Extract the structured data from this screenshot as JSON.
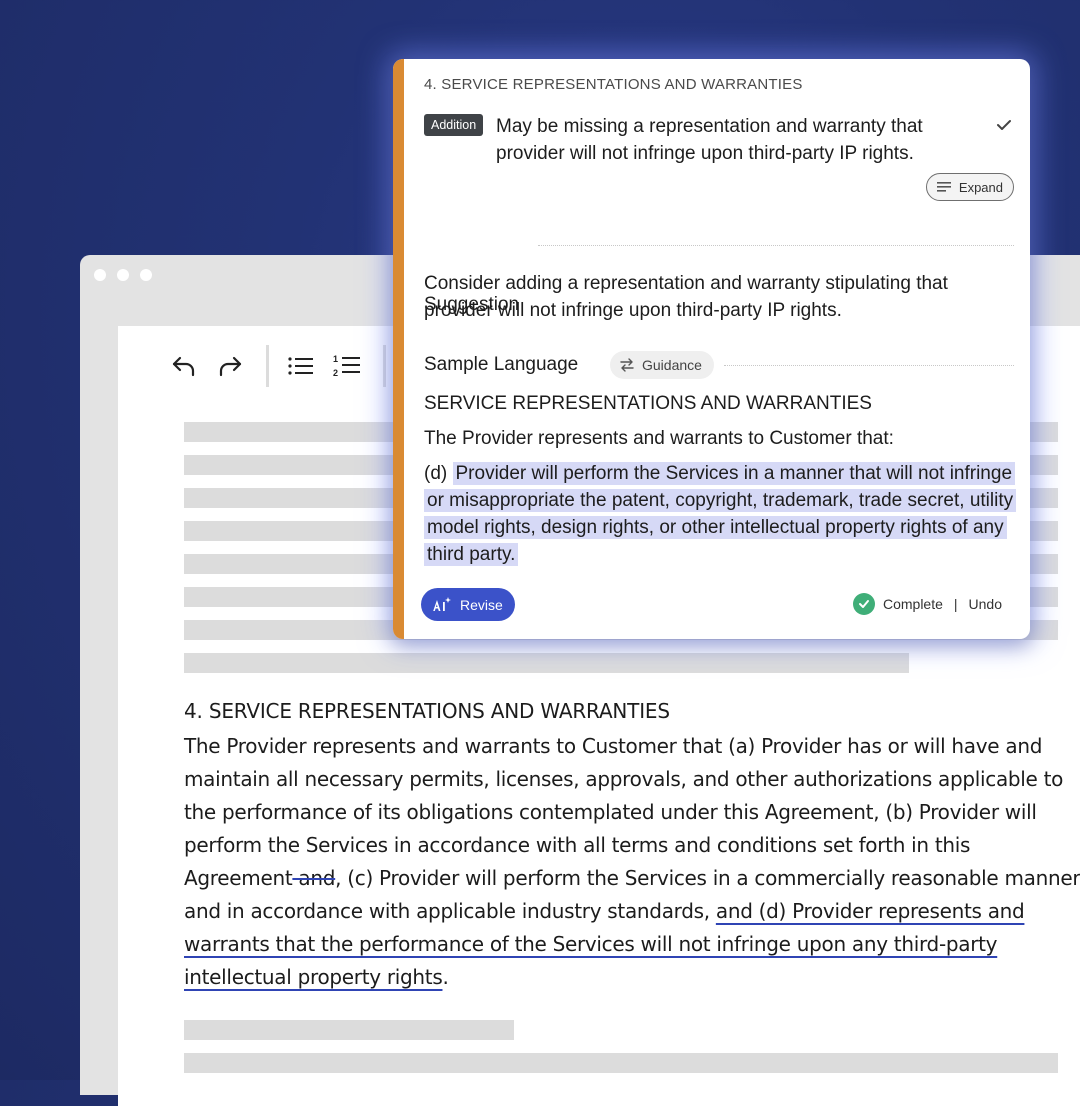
{
  "editor": {
    "toolbar": {
      "undo_icon": "undo-icon",
      "redo_icon": "redo-icon",
      "bullet_list_icon": "bullet-list-icon",
      "numbered_list_icon": "numbered-list-icon"
    },
    "section": {
      "title": "4. SERVICE REPRESENTATIONS AND WARRANTIES",
      "body_part1": "The Provider represents and warrants to Customer that (a) Provider has or will have and maintain all necessary permits, licenses, approvals, and other authorizations applicable to the performance of its obligations contemplated under this Agreement, (b) Provider will perform the Services in accordance with all terms and conditions set forth in this Agreement",
      "deleted_text": " and",
      "body_part2": ", (c) Provider will perform the Services in a commercially reasonable manner and in accordance with applicable industry standards, ",
      "inserted_text": "and (d) Provider represents and warrants that the performance of the Services will not infringe upon any third-party intellectual property rights",
      "body_end": "."
    }
  },
  "card": {
    "heading": "4. SERVICE REPRESENTATIONS AND WARRANTIES",
    "badge": "Addition",
    "issue": "May be missing a representation and warranty that provider will not infringe upon third-party IP rights.",
    "expand_label": "Expand",
    "suggestion_title": "Suggestion",
    "suggestion_text": "Consider adding a representation and warranty stipulating that provider will not infringe upon third-party IP rights.",
    "sample_title": "Sample Language",
    "guidance_label": "Guidance",
    "sample_heading": "SERVICE REPRESENTATIONS AND WARRANTIES",
    "sample_intro": "The Provider represents and warrants to Customer that:",
    "sample_prefix": "(d) ",
    "sample_clause": "Provider will perform the Services in a manner that will not infringe or misappropriate the patent, copyright, trademark, trade secret, utility model rights, design rights, or other intellectual property rights of any third party.",
    "revise_label": "Revise",
    "complete_label": "Complete",
    "separator": "|",
    "undo_label": "Undo",
    "colors": {
      "accent": "#d98a33",
      "revise": "#3b52c9",
      "complete": "#3fae78",
      "highlight": "#d6d9f6"
    }
  }
}
